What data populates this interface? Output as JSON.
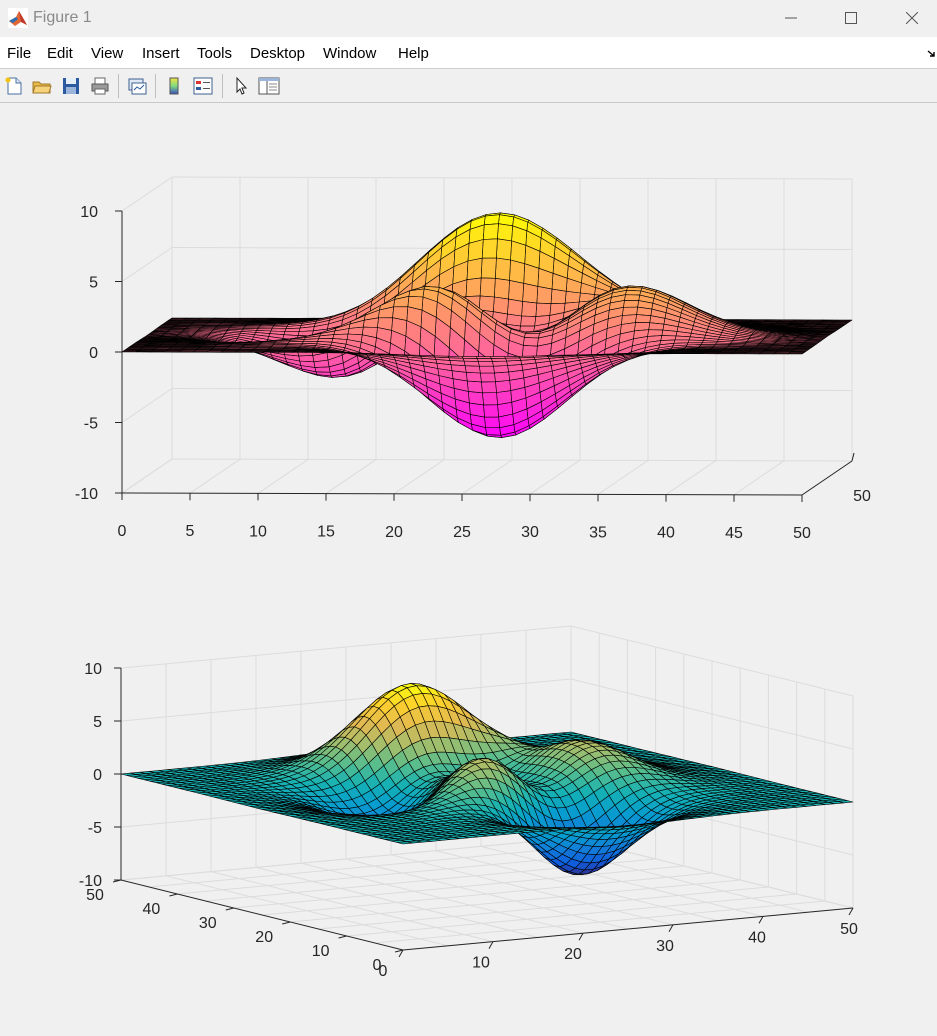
{
  "window": {
    "title": "Figure 1"
  },
  "menu": [
    "File",
    "Edit",
    "View",
    "Insert",
    "Tools",
    "Desktop",
    "Window",
    "Help"
  ],
  "toolbar": [
    "new-figure",
    "open-file",
    "save",
    "print",
    "link-plot",
    "insert-colorbar",
    "insert-legend",
    "edit-plot",
    "property-inspector"
  ],
  "colors": {
    "top_colormap": "spring",
    "bottom_colormap": "parula",
    "edge": "#000000"
  },
  "chart_data": [
    {
      "type": "surface",
      "function": "peaks",
      "grid": [
        49,
        49
      ],
      "colormap": "spring",
      "view": "side",
      "xlim": [
        0,
        50
      ],
      "ylim": [
        0,
        50
      ],
      "zlim": [
        -10,
        10
      ],
      "xticks": [
        "0",
        "5",
        "10",
        "15",
        "20",
        "25",
        "30",
        "35",
        "40",
        "45",
        "50"
      ],
      "yticks": [
        "50"
      ],
      "zticks": [
        "10",
        "5",
        "0",
        "-5",
        "-10"
      ],
      "grid_on": true
    },
    {
      "type": "surface",
      "function": "peaks",
      "grid": [
        49,
        49
      ],
      "colormap": "parula",
      "view": "3d",
      "xlim": [
        0,
        50
      ],
      "ylim": [
        0,
        50
      ],
      "zlim": [
        -10,
        10
      ],
      "xticks": [
        "0",
        "10",
        "20",
        "30",
        "40",
        "50"
      ],
      "yticks": [
        "0",
        "10",
        "20",
        "30",
        "40",
        "50"
      ],
      "zticks": [
        "10",
        "5",
        "0",
        "-5",
        "-10"
      ],
      "grid_on": true
    }
  ]
}
